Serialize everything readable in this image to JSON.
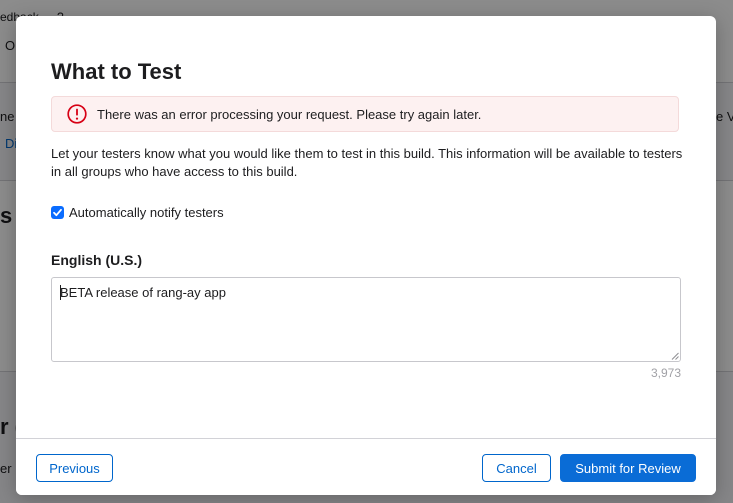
{
  "background": {
    "top_text": "edback",
    "help_mark": "?",
    "left_fragment_1": "Or",
    "left_fragment_2": "ne",
    "left_link": "Di",
    "right_fragment": "e Vi",
    "heading_fragment_1": "s (",
    "heading_fragment_2": "r (",
    "table_fragment": "er"
  },
  "modal": {
    "title": "What to Test",
    "error": {
      "icon": "exclamation-circle-icon",
      "message": "There was an error processing your request. Please try again later."
    },
    "description": "Let your testers know what you would like them to test in this build. This information will be available to testers in all groups who have access to this build.",
    "notify": {
      "label": "Automatically notify testers",
      "checked": true
    },
    "locale_label": "English (U.S.)",
    "textarea": {
      "value": "BETA release of rang-ay app"
    },
    "char_count": "3,973",
    "buttons": {
      "previous": "Previous",
      "cancel": "Cancel",
      "submit": "Submit for Review"
    }
  },
  "colors": {
    "accent": "#0066cc",
    "primary_button": "#0a6cd6",
    "error": "#d70015",
    "error_background": "#fdf1f1"
  }
}
